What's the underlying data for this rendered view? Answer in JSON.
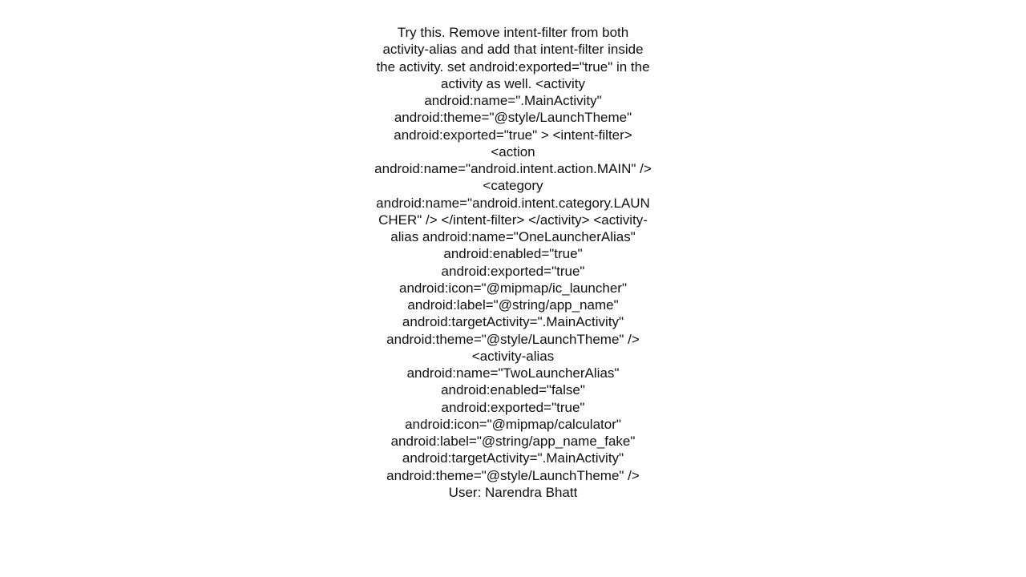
{
  "post": {
    "body": "Try this.  Remove intent-filter from both activity-alias and add that intent-filter inside the activity.  set android:exported=\"true\" in the activity as well. <activity     android:name=\".MainActivity\"     android:theme=\"@style/LaunchTheme\"     android:exported=\"true\"     >     <intent-filter>         <action android:name=\"android.intent.action.MAIN\" />         <category android:name=\"android.intent.category.LAUNCHER\" />     </intent-filter> </activity>  <activity-alias     android:name=\"OneLauncherAlias\"     android:enabled=\"true\"     android:exported=\"true\"     android:icon=\"@mipmap/ic_launcher\"     android:label=\"@string/app_name\"     android:targetActivity=\".MainActivity\"     android:theme=\"@style/LaunchTheme\" /> <activity-alias     android:name=\"TwoLauncherAlias\"     android:enabled=\"false\"     android:exported=\"true\"     android:icon=\"@mipmap/calculator\"     android:label=\"@string/app_name_fake\"     android:targetActivity=\".MainActivity\"     android:theme=\"@style/LaunchTheme\" />",
    "user_prefix": "User: ",
    "user_name": "Narendra Bhatt"
  }
}
